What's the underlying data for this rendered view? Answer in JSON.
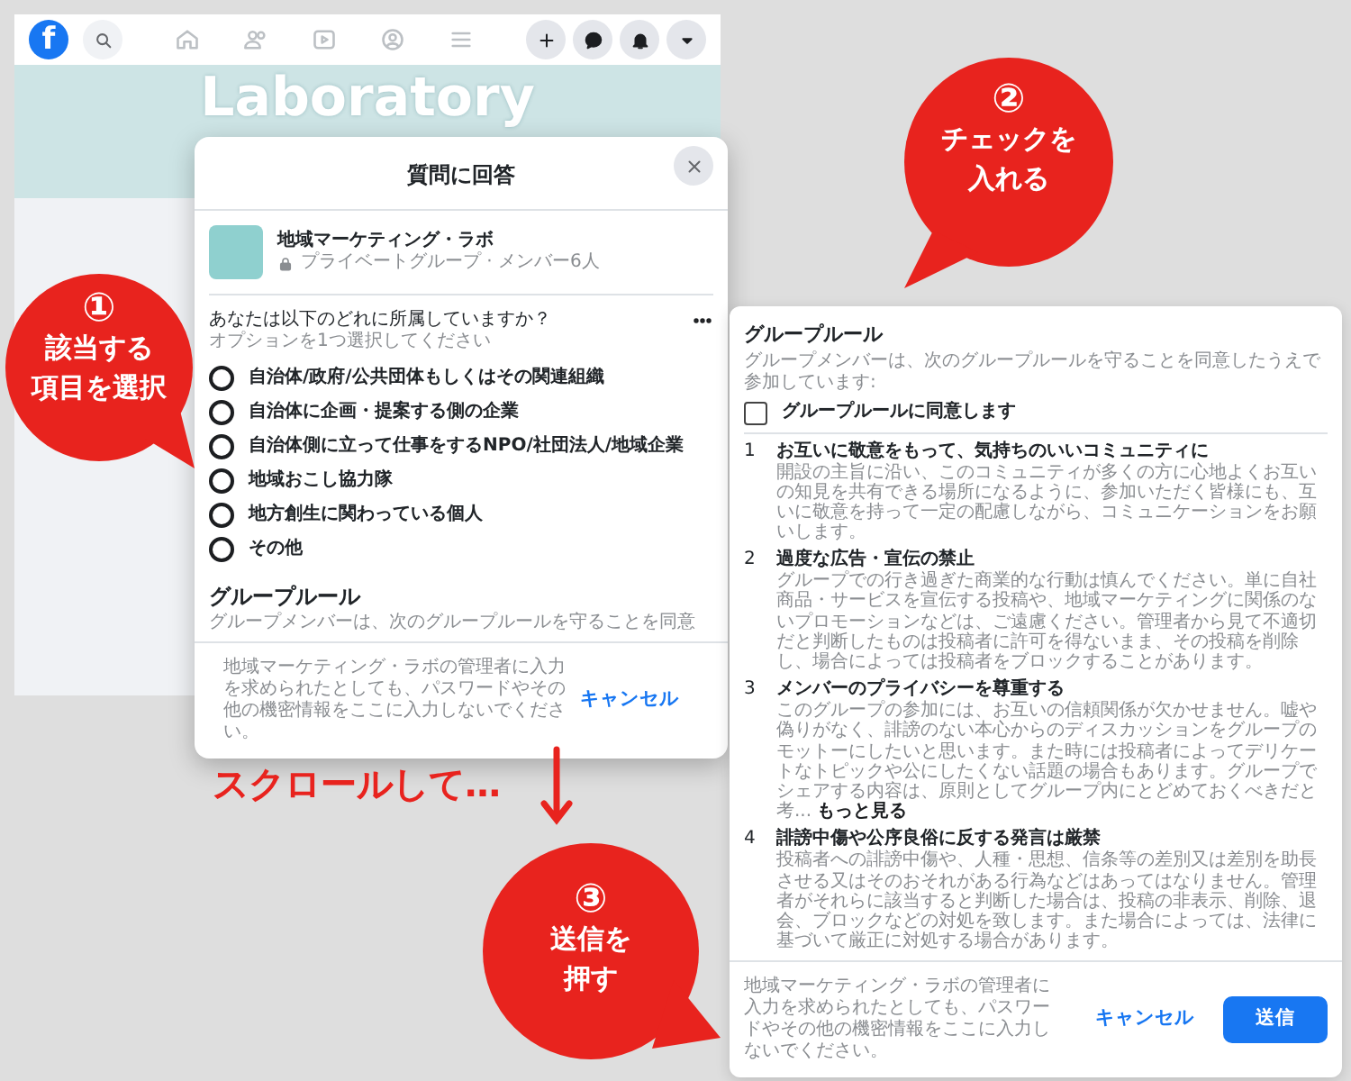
{
  "screenshot_1": {
    "logo": "f",
    "banner_title": "Laboratory",
    "dialog": {
      "title": "質問に回答",
      "group_name": "地域マーケティング・ラボ",
      "group_meta": "プライベートグループ · メンバー6人",
      "question": "あなたは以下のどれに所属していますか？",
      "question_hint": "オプションを1つ選択してください",
      "options": [
        {
          "label": "自治体/政府/公共団体もしくはその関連組織",
          "selected": false
        },
        {
          "label": "自治体に企画・提案する側の企業",
          "selected": false
        },
        {
          "label": "自治体側に立って仕事をするNPO/社団法人/地域企業",
          "selected": false
        },
        {
          "label": "地域おこし協力隊",
          "selected": false
        },
        {
          "label": "地方創生に関わっている個人",
          "selected": false
        },
        {
          "label": "その他",
          "selected": false
        }
      ],
      "rules_title": "グループルール",
      "rules_intro": "グループメンバーは、次のグループルールを守ることを同意",
      "notice": "地域マーケティング・ラボの管理者に入力を求められたとしても、パスワードやその他の機密情報をここに入力しないでください。",
      "cancel": "キャンセル"
    }
  },
  "screenshot_2": {
    "rules_title": "グループルール",
    "rules_intro": "グループメンバーは、次のグループルールを守ることを同意したうえで参加しています:",
    "agree": {
      "label": "グループルールに同意します",
      "checked": false
    },
    "rules": [
      {
        "number": "1",
        "title": "お互いに敬意をもって、気持ちのいいコミュニティに",
        "body": "開設の主旨に沿い、このコミュニティが多くの方に心地よくお互いの知見を共有できる場所になるように、参加いただく皆様にも、互いに敬意を持って一定の配慮しながら、コミュニケーションをお願いします。"
      },
      {
        "number": "2",
        "title": "過度な広告・宣伝の禁止",
        "body": "グループでの行き過ぎた商業的な行動は慎んでください。単に自社商品・サービスを宣伝する投稿や、地域マーケティングに関係のないプロモーションなどは、ご遠慮ください。管理者から見て不適切だと判断したものは投稿者に許可を得ないまま、その投稿を削除し、場合によっては投稿者をブロックすることがあります。"
      },
      {
        "number": "3",
        "title": "メンバーのプライバシーを尊重する",
        "body": "このグループの参加には、お互いの信頼関係が欠かせません。嘘や偽りがなく、誹謗のない本心からのディスカッションをグループのモットーにしたいと思います。また時には投稿者によってデリケートなトピックや公にしたくない話題の場合もあります。グループでシェアする内容は、原則としてグループ内にとどめておくべきだと考...",
        "more_link": "もっと見る"
      },
      {
        "number": "4",
        "title": "誹謗中傷や公序良俗に反する発言は厳禁",
        "body": "投稿者への誹謗中傷や、人種・思想、信条等の差別又は差別を助長させる又はそのおそれがある行為などはあってはなりません。管理者がそれらに該当すると判断した場合は、投稿の非表示、削除、退会、ブロックなどの対処を致します。また場合によっては、法律に基づいて厳正に対処する場合があります。"
      }
    ],
    "notice": "地域マーケティング・ラボの管理者に入力を求められたとしても、パスワードやその他の機密情報をここに入力しないでください。",
    "cancel": "キャンセル",
    "submit": "送信"
  },
  "callouts": [
    {
      "number": "①",
      "lines": [
        "該当する",
        "項目を選択"
      ]
    },
    {
      "number": "②",
      "lines": [
        "チェックを",
        "入れる"
      ]
    },
    {
      "number": "③",
      "lines": [
        "送信を",
        "押す"
      ]
    }
  ],
  "scroll_hint": "スクロールして…"
}
